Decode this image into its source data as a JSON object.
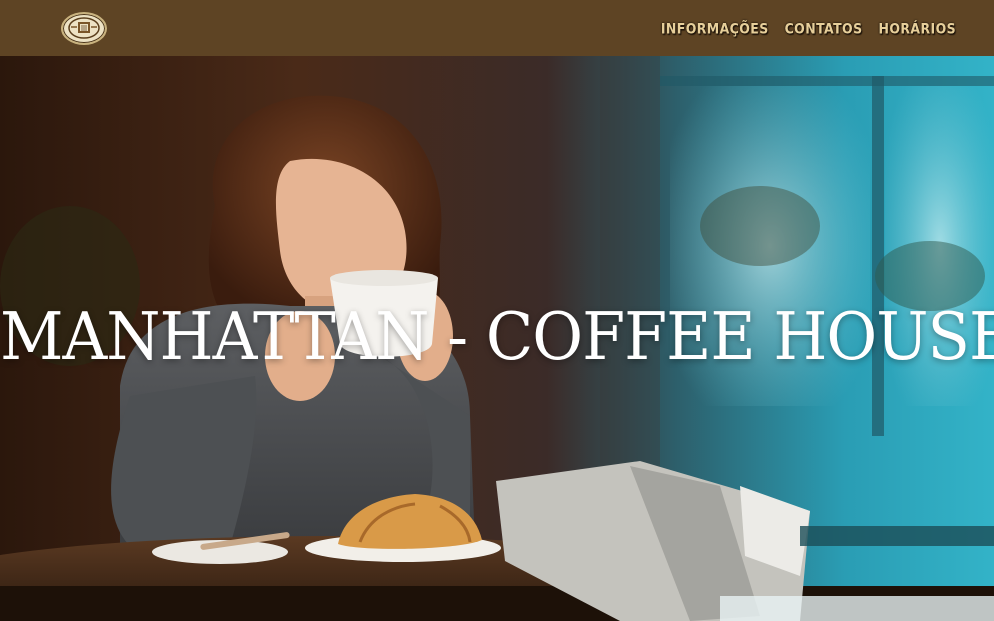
{
  "header": {
    "logo_icon": "coffee-house-emblem",
    "nav": [
      {
        "label": "INFORMAÇÕES"
      },
      {
        "label": "CONTATOS"
      },
      {
        "label": "HORÁRIOS"
      }
    ]
  },
  "hero": {
    "title": "MANHATTAN - COFFEE HOUSE",
    "background": "photo of a woman sipping coffee at a café table with a croissant"
  },
  "colors": {
    "navbar": "#5e4424",
    "nav_text": "#e7cf9a",
    "title": "#ffffff"
  }
}
